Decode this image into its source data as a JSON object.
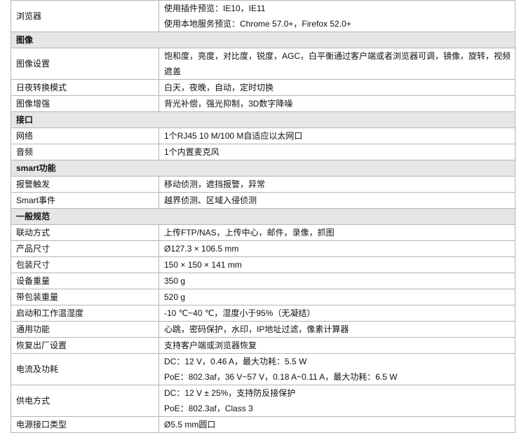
{
  "rows": [
    {
      "type": "row",
      "label": "浏览器",
      "lines": [
        "使用插件预览：IE10，IE11",
        "使用本地服务预览：Chrome 57.0+，Firefox 52.0+"
      ],
      "shade": false
    },
    {
      "type": "section",
      "label": "图像"
    },
    {
      "type": "row",
      "label": "图像设置",
      "lines": [
        "饱和度，亮度，对比度，锐度，AGC，白平衡通过客户端或者浏览器可调，镜像，旋转，视频遮盖"
      ],
      "shade": false
    },
    {
      "type": "row",
      "label": "日夜转换模式",
      "lines": [
        "白天，夜晚，自动，定时切换"
      ],
      "shade": false
    },
    {
      "type": "row",
      "label": "图像增强",
      "lines": [
        "背光补偿，强光抑制，3D数字降噪"
      ],
      "shade": false
    },
    {
      "type": "section",
      "label": "接口"
    },
    {
      "type": "row",
      "label": "网络",
      "lines": [
        "1个RJ45 10 M/100 M自适应以太网口"
      ],
      "shade": false
    },
    {
      "type": "row",
      "label": "音频",
      "lines": [
        "1个内置麦克风"
      ],
      "shade": false
    },
    {
      "type": "section",
      "label": "smart功能"
    },
    {
      "type": "row",
      "label": "报警触发",
      "lines": [
        "移动侦测，遮挡报警，异常"
      ],
      "shade": false
    },
    {
      "type": "row",
      "label": "Smart事件",
      "lines": [
        "越界侦测、区域入侵侦测"
      ],
      "shade": false
    },
    {
      "type": "section",
      "label": "一般规范"
    },
    {
      "type": "row",
      "label": "联动方式",
      "lines": [
        "上传FTP/NAS，上传中心，邮件，录像，抓图"
      ],
      "shade": false
    },
    {
      "type": "row",
      "label": "产品尺寸",
      "lines": [
        "Ø127.3 × 106.5 mm"
      ],
      "shade": false
    },
    {
      "type": "row",
      "label": "包装尺寸",
      "lines": [
        "150 × 150 × 141 mm"
      ],
      "shade": false
    },
    {
      "type": "row",
      "label": "设备重量",
      "lines": [
        "350 g"
      ],
      "shade": false
    },
    {
      "type": "row",
      "label": "带包装重量",
      "lines": [
        "520 g"
      ],
      "shade": false
    },
    {
      "type": "row",
      "label": "启动和工作温湿度",
      "lines": [
        "-10 ℃~40 ℃，湿度小于95%（无凝结）"
      ],
      "shade": false
    },
    {
      "type": "row",
      "label": "通用功能",
      "lines": [
        "心跳，密码保护，水印，IP地址过滤，像素计算器"
      ],
      "shade": false
    },
    {
      "type": "row",
      "label": "恢复出厂设置",
      "lines": [
        "支持客户端或浏览器恢复"
      ],
      "shade": false
    },
    {
      "type": "row",
      "label": "电流及功耗",
      "lines": [
        "DC：12 V，0.46 A，最大功耗：5.5 W",
        "PoE：802.3af，36 V~57 V，0.18 A~0.11 A，最大功耗：6.5 W"
      ],
      "shade": false
    },
    {
      "type": "row",
      "label": "供电方式",
      "lines": [
        "DC：12 V ± 25%，支持防反接保护",
        "PoE：802.3af，Class 3"
      ],
      "shade": false
    },
    {
      "type": "row",
      "label": "电源接口类型",
      "lines": [
        "Ø5.5 mm圆口"
      ],
      "shade": false
    }
  ]
}
